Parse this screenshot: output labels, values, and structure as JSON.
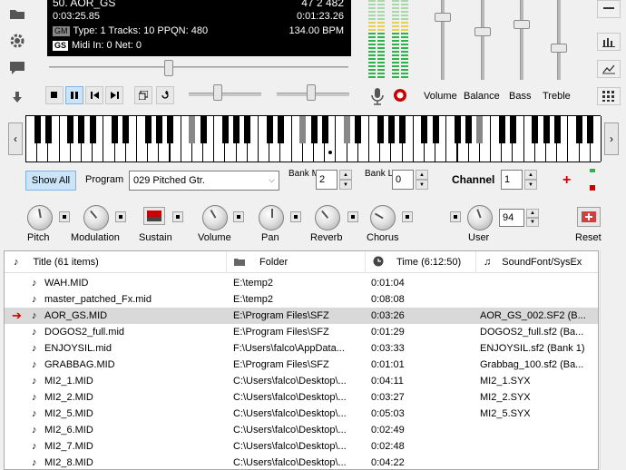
{
  "display": {
    "title": "50. AOR_GS",
    "time": "0:03:25.85",
    "gm_tag": "GM",
    "gs_tag": "GS",
    "info": "Type: 1  Tracks: 10  PPQN: 480",
    "midi": "Midi In: 0  Net: 0",
    "position": "47  2  482",
    "total_time": "0:01:23.26",
    "tempo": "134.00 BPM"
  },
  "mixer": {
    "labels": [
      "Volume",
      "Balance",
      "Bass",
      "Treble"
    ]
  },
  "program_row": {
    "show_all": "Show All",
    "program_label": "Program",
    "program_value": "029 Pitched Gtr.",
    "bank_msb_label": "Bank MSB",
    "bank_msb_value": "2",
    "bank_lsb_label": "Bank LSB",
    "bank_lsb_value": "0",
    "channel_label": "Channel",
    "channel_value": "1"
  },
  "controls": {
    "knobs": [
      "Pitch",
      "Modulation",
      "Sustain",
      "Volume",
      "Pan",
      "Reverb",
      "Chorus",
      "User",
      "Reset"
    ],
    "user_value": "94"
  },
  "list": {
    "headers": [
      "Title (61 items)",
      "Folder",
      "Time (6:12:50)",
      "SoundFont/SysEx"
    ],
    "rows": [
      {
        "title": "WAH.MID",
        "folder": "E:\\temp2",
        "time": "0:01:04",
        "sf": ""
      },
      {
        "title": "master_patched_Fx.mid",
        "folder": "E:\\temp2",
        "time": "0:08:08",
        "sf": ""
      },
      {
        "title": "AOR_GS.MID",
        "folder": "E:\\Program Files\\SFZ",
        "time": "0:03:26",
        "sf": "AOR_GS_002.SF2 (B..."
      },
      {
        "title": "DOGOS2_full.mid",
        "folder": "E:\\Program Files\\SFZ",
        "time": "0:01:29",
        "sf": "DOGOS2_full.sf2 (Ba..."
      },
      {
        "title": "ENJOYSIL.mid",
        "folder": "F:\\Users\\falco\\AppData...",
        "time": "0:03:33",
        "sf": "ENJOYSIL.sf2 (Bank 1)"
      },
      {
        "title": "GRABBAG.MID",
        "folder": "E:\\Program Files\\SFZ",
        "time": "0:01:01",
        "sf": "Grabbag_100.sf2 (Ba..."
      },
      {
        "title": "MI2_1.MID",
        "folder": "C:\\Users\\falco\\Desktop\\...",
        "time": "0:04:11",
        "sf": "MI2_1.SYX"
      },
      {
        "title": "MI2_2.MID",
        "folder": "C:\\Users\\falco\\Desktop\\...",
        "time": "0:03:27",
        "sf": "MI2_2.SYX"
      },
      {
        "title": "MI2_5.MID",
        "folder": "C:\\Users\\falco\\Desktop\\...",
        "time": "0:05:03",
        "sf": "MI2_5.SYX"
      },
      {
        "title": "MI2_6.MID",
        "folder": "C:\\Users\\falco\\Desktop\\...",
        "time": "0:02:49",
        "sf": ""
      },
      {
        "title": "MI2_7.MID",
        "folder": "C:\\Users\\falco\\Desktop\\...",
        "time": "0:02:48",
        "sf": ""
      },
      {
        "title": "MI2_8.MID",
        "folder": "C:\\Users\\falco\\Desktop\\...",
        "time": "0:04:22",
        "sf": ""
      }
    ]
  },
  "colors": {
    "accent_red": "#cc0000",
    "meter_green": "#2db34a",
    "meter_dim": "#a8d8a8"
  }
}
